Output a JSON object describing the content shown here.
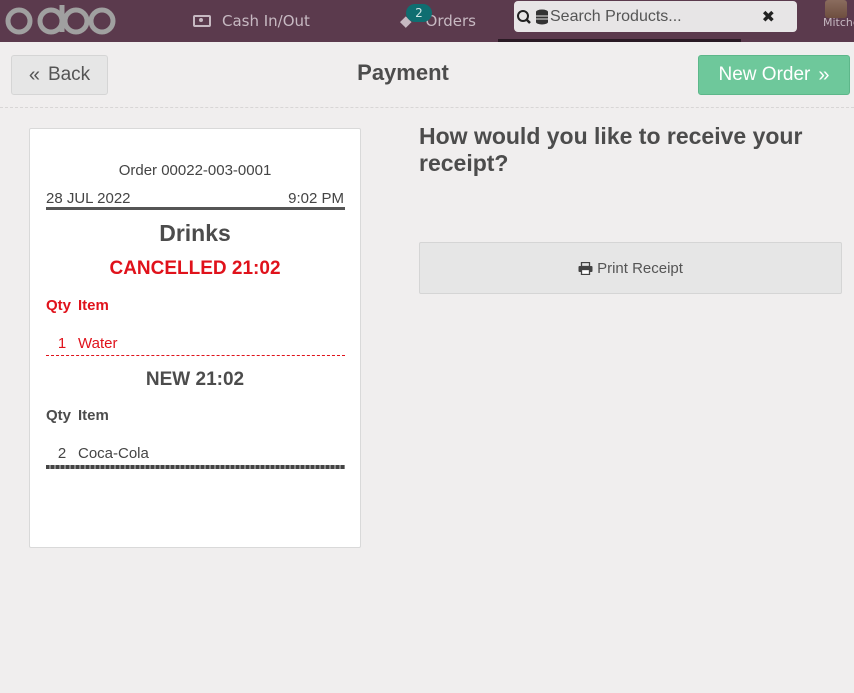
{
  "topbar": {
    "logo_text": "odoo",
    "cash_label": "Cash In/Out",
    "orders_label": "Orders",
    "orders_badge": "2",
    "search_placeholder": "Search Products...",
    "user_name": "Mitchell Admin"
  },
  "header": {
    "back_label": "Back",
    "title": "Payment",
    "new_order_label": "New Order"
  },
  "receipt": {
    "order_ref": "Order 00022-003-0001",
    "date": "28 JUL 2022",
    "time": "9:02 PM",
    "printer_name": "Drinks",
    "cancelled_section": {
      "title": "CANCELLED 21:02",
      "qty_header": "Qty",
      "item_header": "Item",
      "lines": [
        {
          "qty": "1",
          "item": "Water"
        }
      ]
    },
    "new_section": {
      "title": "NEW 21:02",
      "qty_header": "Qty",
      "item_header": "Item",
      "lines": [
        {
          "qty": "2",
          "item": "Coca-Cola"
        }
      ]
    }
  },
  "panel": {
    "question": "How would you like to receive your receipt?",
    "print_label": "Print Receipt"
  },
  "colors": {
    "topbar": "#5b3a4d",
    "accent_green": "#6ec89b",
    "cancel_red": "#e0121b",
    "badge_teal": "#0f6e71"
  }
}
